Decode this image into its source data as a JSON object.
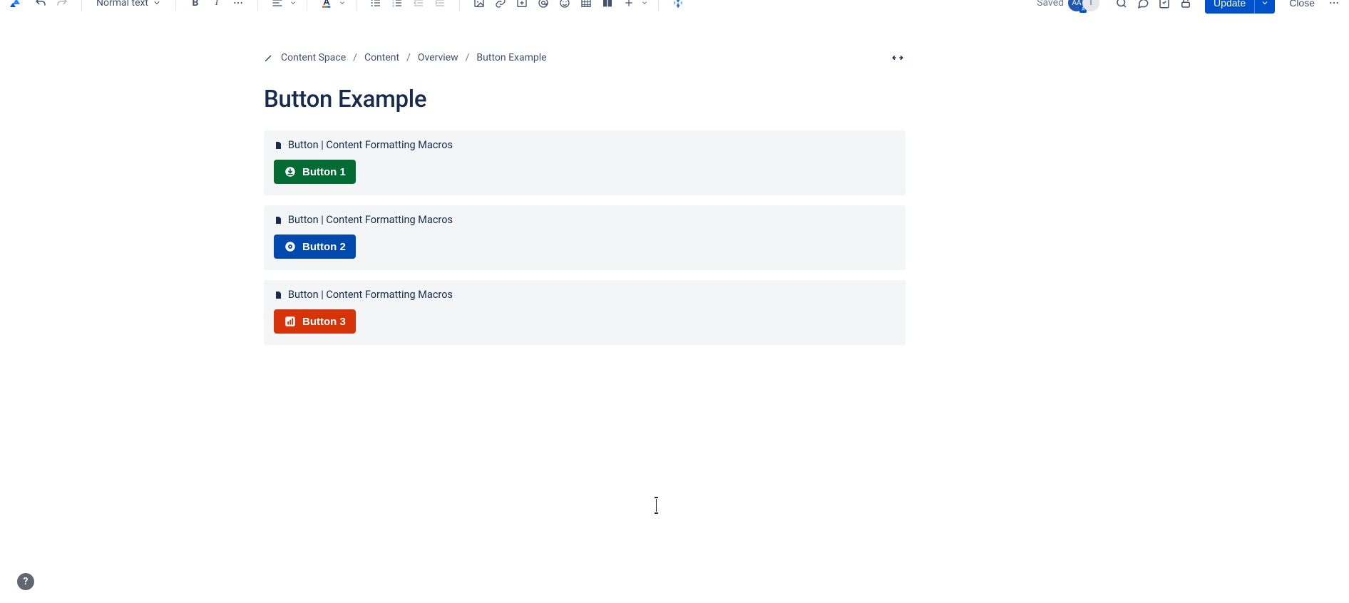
{
  "toolbar": {
    "text_style_label": "Normal text",
    "saved_label": "Saved",
    "update_label": "Update",
    "close_label": "Close",
    "avatar_initials": "AA",
    "avatar_badge": "A",
    "avatar_second_initial": "I"
  },
  "breadcrumbs": {
    "items": [
      "Content Space",
      "Content",
      "Overview",
      "Button Example"
    ],
    "separator": "/"
  },
  "page": {
    "title": "Button Example"
  },
  "macros": [
    {
      "label": "Button | Content Formatting Macros",
      "button_text": "Button 1",
      "color": "green",
      "icon": "download-circle"
    },
    {
      "label": "Button | Content Formatting Macros",
      "button_text": "Button 2",
      "color": "blue",
      "icon": "eye-circle"
    },
    {
      "label": "Button | Content Formatting Macros",
      "button_text": "Button 3",
      "color": "red",
      "icon": "chart-square"
    }
  ],
  "help": {
    "glyph": "?"
  }
}
